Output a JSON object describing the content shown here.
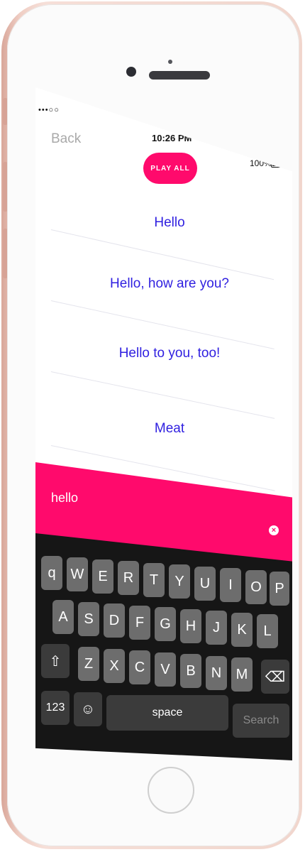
{
  "status_bar": {
    "signal": "•••○○",
    "time": "10:26 PM",
    "battery": "100%"
  },
  "nav": {
    "back_label": "Back"
  },
  "play_all_label": "PLAY ALL",
  "phrases": [
    "Hello",
    "Hello, how are you?",
    "Hello to you, too!",
    "Meat"
  ],
  "search": {
    "value": "hello",
    "clear_icon": "×"
  },
  "accent_color": "#ff0a6c",
  "phrase_color": "#2f1fe0",
  "keyboard": {
    "row1": [
      "q",
      "W",
      "E",
      "R",
      "T",
      "Y",
      "U",
      "I",
      "O",
      "P"
    ],
    "row2": [
      "A",
      "S",
      "D",
      "F",
      "G",
      "H",
      "J",
      "K",
      "L"
    ],
    "row3": [
      "Z",
      "X",
      "C",
      "V",
      "B",
      "N",
      "M"
    ],
    "shift_icon": "⇧",
    "delete_icon": "⌫",
    "numbers_label": "123",
    "emoji_icon": "☺",
    "space_label": "space",
    "search_label": "Search"
  }
}
